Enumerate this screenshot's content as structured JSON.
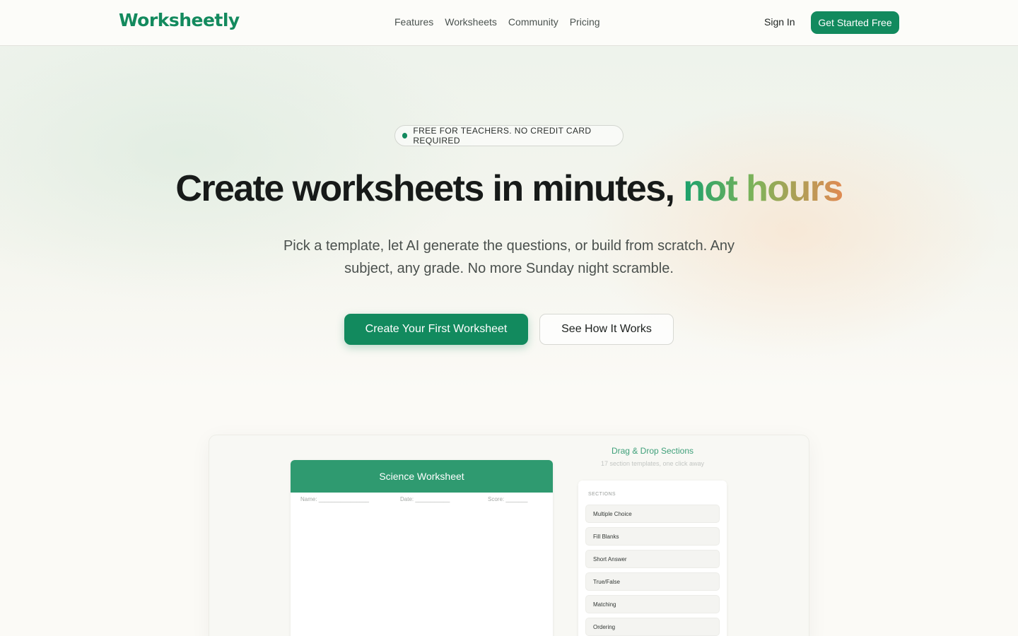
{
  "nav": {
    "logo": "Worksheetly",
    "links": [
      "Features",
      "Worksheets",
      "Community",
      "Pricing"
    ],
    "sign_in": "Sign In",
    "cta": "Get Started Free"
  },
  "hero": {
    "badge": "FREE FOR TEACHERS. NO CREDIT CARD REQUIRED",
    "headline_main": "Create worksheets in minutes,",
    "headline_accent": "not hours",
    "subtitle": "Pick a template, let AI generate the questions, or build from scratch. Any subject, any grade. No more Sunday night scramble.",
    "primary_button": "Create Your First Worksheet",
    "secondary_button": "See How It Works"
  },
  "preview": {
    "worksheet_title": "Science Worksheet",
    "fields": {
      "name": "Name: ________________",
      "date": "Date: ___________",
      "score": "Score: _______"
    },
    "dragdrop_title": "Drag & Drop Sections",
    "dragdrop_subtitle": "17 section templates, one click away",
    "sections_label": "SECTIONS",
    "sections": [
      "Multiple Choice",
      "Fill Blanks",
      "Short Answer",
      "True/False",
      "Matching",
      "Ordering"
    ]
  },
  "colors": {
    "brand": "#128a5e",
    "accent_gradient_start": "#19a06c",
    "accent_gradient_end": "#e08a52"
  }
}
